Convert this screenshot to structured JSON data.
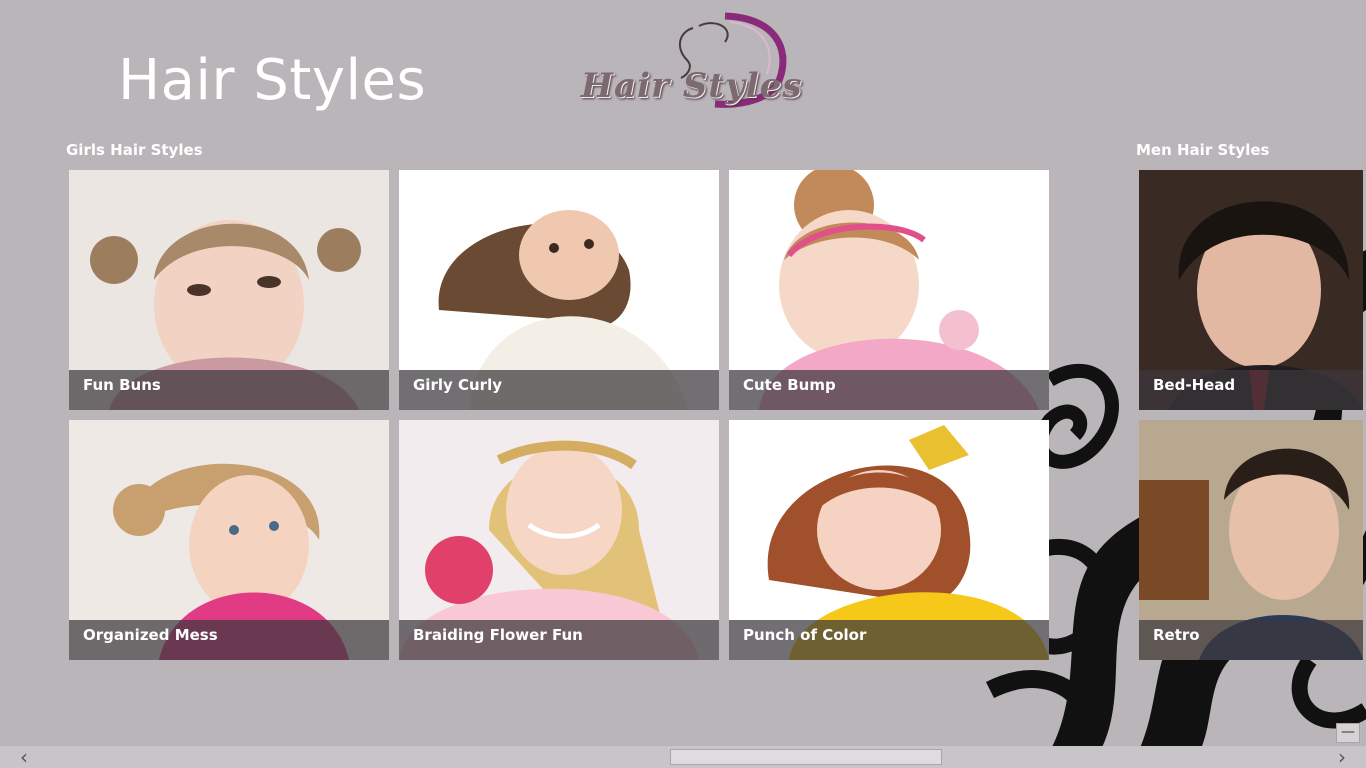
{
  "app": {
    "title": "Hair Styles",
    "logo_text": "Hair Styles"
  },
  "groups": [
    {
      "header": "Girls Hair Styles",
      "tiles": [
        {
          "label": "Fun Buns"
        },
        {
          "label": "Girly Curly"
        },
        {
          "label": "Cute Bump"
        },
        {
          "label": "Organized Mess"
        },
        {
          "label": "Braiding Flower Fun"
        },
        {
          "label": "Punch of Color"
        }
      ]
    },
    {
      "header": "Men Hair Styles",
      "tiles": [
        {
          "label": "Bed-Head"
        },
        {
          "label": "Retro"
        }
      ]
    }
  ],
  "controls": {
    "minimize_label": "—",
    "scroll_left": "‹",
    "scroll_right": "›"
  },
  "colors": {
    "background": "#b9b5b9",
    "caption_overlay": "#3c373c",
    "accent_purple": "#8a2a7a"
  },
  "icons": [
    "minimize-icon",
    "chevron-left-icon",
    "chevron-right-icon"
  ]
}
